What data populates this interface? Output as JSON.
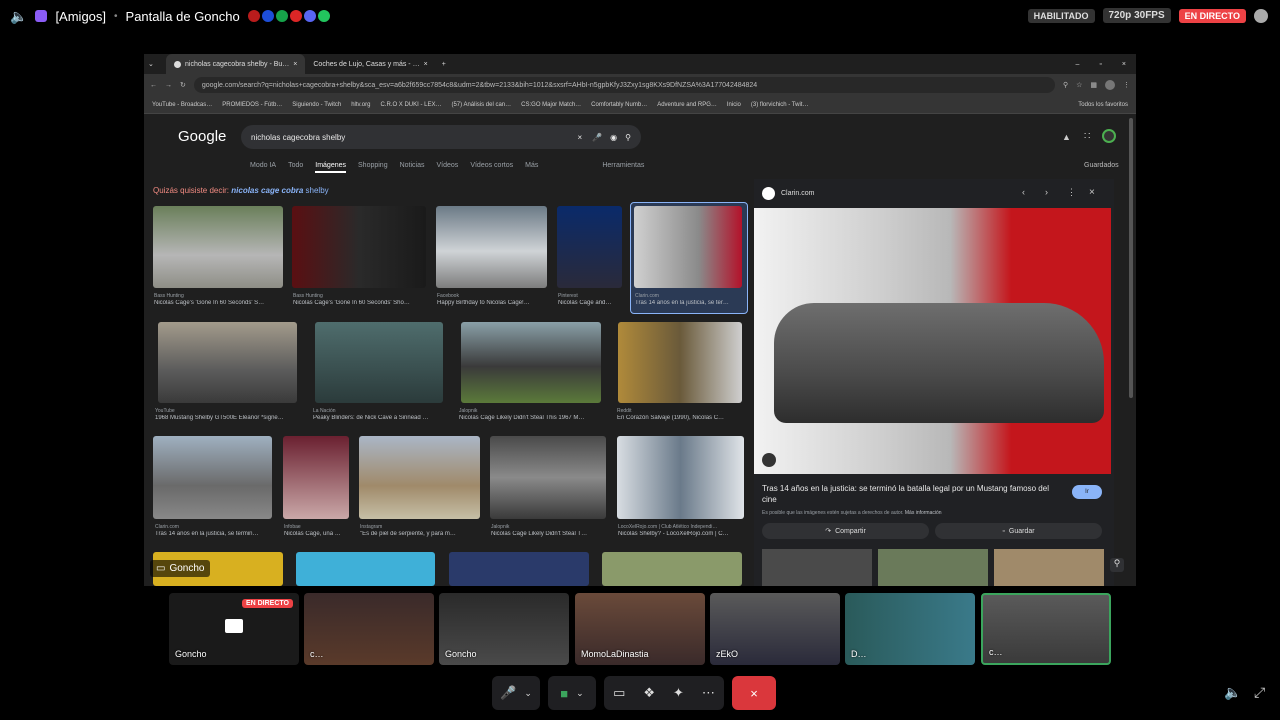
{
  "topbar": {
    "channel": "[Amigos]",
    "title": "Pantalla de Goncho",
    "status_habilitado": "HABILITADO",
    "quality": "720p 30FPS",
    "live": "EN DIRECTO"
  },
  "browser": {
    "tabs": [
      "nicholas cagecobra shelby - Bu…",
      "Coches de Lujo, Casas y más - …"
    ],
    "url": "google.com/search?q=nicholas+cagecobra+shelby&sca_esv=a6b2f659cc7854c8&udm=2&tbw=2133&bih=1012&sxsrf=AHbI-n5gpbKfyJ3Zxy1sg8KXs9DfNZSA%3A177042484824",
    "bookmarks": [
      "YouTube - Broadcas…",
      "PROMIEDOS - Fútb…",
      "Siguiendo - Twitch",
      "hltv.org",
      "C.R.O X DUKI - LEX…",
      "(57) Análisis del can…",
      "CS:GO Major Match…",
      "Comfortably Numb…",
      "Adventure and RPG…",
      "Inicio",
      "(3) florvichich - Twit…"
    ],
    "bookmarks_all": "Todos los favoritos"
  },
  "google": {
    "logo": "Google",
    "query": "nicholas cagecobra shelby",
    "tabs": [
      "Modo IA",
      "Todo",
      "Imágenes",
      "Shopping",
      "Noticias",
      "Vídeos",
      "Vídeos cortos",
      "Más"
    ],
    "herramientas": "Herramientas",
    "guardados": "Guardados",
    "suggest_prefix": "Quizás quisiste decir:",
    "suggest_bold": "nicolas cage cobra",
    "suggest_rest": "shelby"
  },
  "results": [
    {
      "src": "Bass Hunting",
      "cap": "Nicolas Cage's 'Gone In 60 Seconds' S…"
    },
    {
      "src": "Bass Hunting",
      "cap": "Nicolas Cage's 'Gone In 60 Seconds' Sho…"
    },
    {
      "src": "Facebook",
      "cap": "Happy Birthday to Nicolas Cage!…"
    },
    {
      "src": "Pinterest",
      "cap": "Nicolas Cage and…"
    },
    {
      "src": "Clarin.com",
      "cap": "Tras 14 años en la justicia, se ter…"
    },
    {
      "src": "YouTube",
      "cap": "1968 Mustang Shelby GT500E Eleanor *signe…"
    },
    {
      "src": "La Nación",
      "cap": "Peaky Blinders: de Nick Cave a Sinnead …"
    },
    {
      "src": "Jalopnik",
      "cap": "Nicolas Cage Likely Didn't Steal This 1967 M…"
    },
    {
      "src": "Reddit",
      "cap": "En Corazón Salvaje (1990), Nicolas C…"
    },
    {
      "src": "Clarin.com",
      "cap": "Tras 14 años en la justicia, se termin…"
    },
    {
      "src": "Infobae",
      "cap": "Nicolas Cage, una …"
    },
    {
      "src": "Instagram",
      "cap": "\"Es de piel de serpiente, y para m…"
    },
    {
      "src": "Jalopnik",
      "cap": "Nicolas Cage Likely Didn't Steal T…"
    },
    {
      "src": "LocoXelRojo.com | Club Atlético Independi…",
      "cap": "Nicolás Shelby? - LocoXelRojo.com | C…"
    }
  ],
  "panel": {
    "source": "Clarin.com",
    "title": "Tras 14 años en la justicia: se terminó la batalla legal por un Mustang famoso del cine",
    "visit": "Ir",
    "notice": "Es posible que las imágenes estén sujetas a derechos de autor.",
    "more_info": "Más información",
    "share": "Compartir",
    "save": "Guardar"
  },
  "overlay_name": "Goncho",
  "participants": [
    {
      "name": "Goncho",
      "badge": "EN DIRECTO"
    },
    {
      "name": "c…",
      "badge": ""
    },
    {
      "name": "Goncho",
      "badge": ""
    },
    {
      "name": "MomoLaDinastia",
      "badge": ""
    },
    {
      "name": "zEkO",
      "badge": ""
    },
    {
      "name": "D…",
      "badge": ""
    },
    {
      "name": "c…",
      "badge": ""
    }
  ]
}
